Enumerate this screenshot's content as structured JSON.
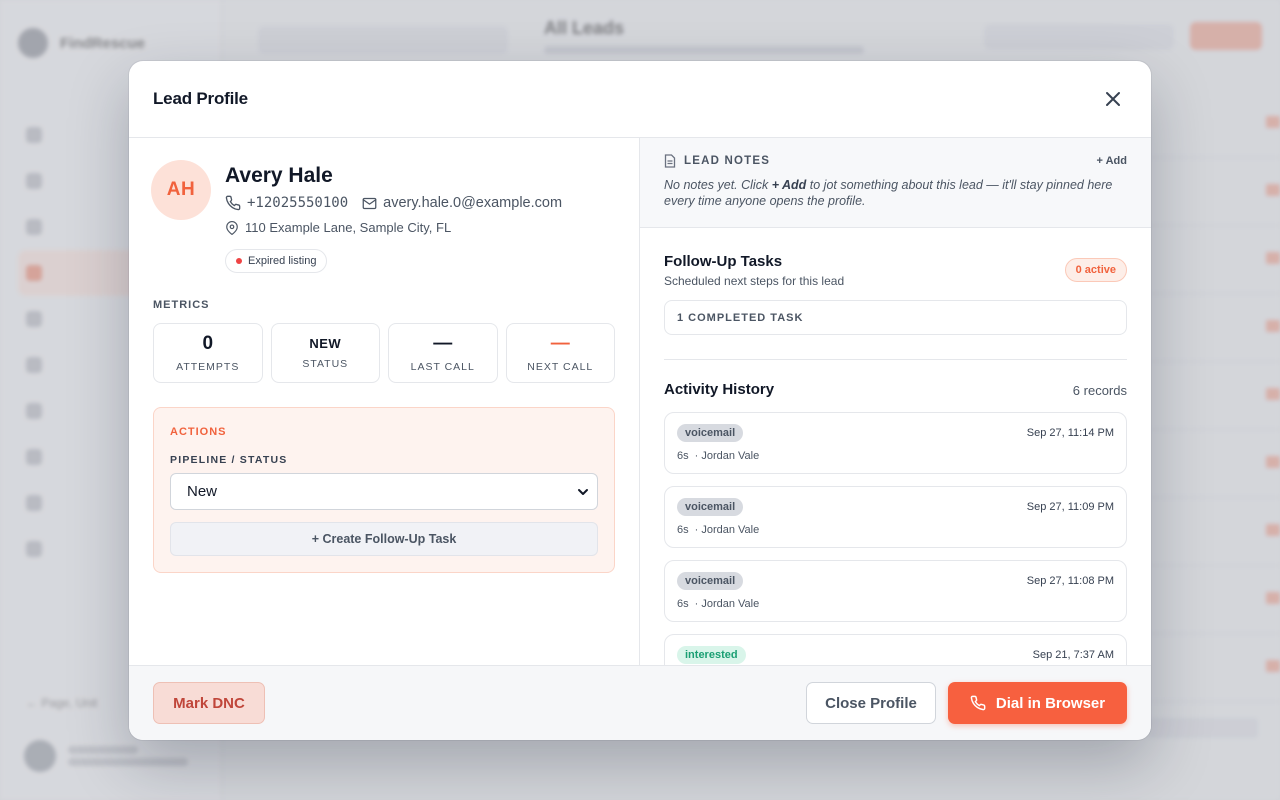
{
  "background": {
    "brand": "FindRescue",
    "page_title": "All Leads",
    "footer_link": "← Page, Unit"
  },
  "modal": {
    "title": "Lead Profile",
    "lead": {
      "initials": "AH",
      "name": "Avery Hale",
      "phone": "+12025550100",
      "email": "avery.hale.0@example.com",
      "address": "110 Example Lane, Sample City, FL",
      "tag": "Expired listing"
    },
    "metrics_label": "METRICS",
    "metrics": [
      {
        "value": "0",
        "label": "ATTEMPTS"
      },
      {
        "value": "NEW",
        "label": "STATUS"
      },
      {
        "value": "—",
        "label": "LAST CALL"
      },
      {
        "value": "—",
        "label": "NEXT CALL"
      }
    ],
    "actions": {
      "label": "ACTIONS",
      "pipeline_label": "PIPELINE / STATUS",
      "selected_status": "New",
      "create_task_label": "+ Create Follow-Up Task"
    },
    "notes": {
      "title": "LEAD NOTES",
      "add_label": "+ Add",
      "empty_before": "No notes yet. Click ",
      "empty_bold": "+ Add",
      "empty_after": " to jot something about this lead — it'll stay pinned here every time anyone opens the profile."
    },
    "follow_up": {
      "title": "Follow-Up Tasks",
      "subtitle": "Scheduled next steps for this lead",
      "active_badge": "0 active",
      "completed_label": "1 COMPLETED TASK"
    },
    "activity": {
      "title": "Activity History",
      "count": "6 records",
      "records": [
        {
          "outcome": "voicemail",
          "time": "Sep 27, 11:14 PM",
          "duration": "6s",
          "agent": "· Jordan Vale"
        },
        {
          "outcome": "voicemail",
          "time": "Sep 27, 11:09 PM",
          "duration": "6s",
          "agent": "· Jordan Vale"
        },
        {
          "outcome": "voicemail",
          "time": "Sep 27, 11:08 PM",
          "duration": "6s",
          "agent": "· Jordan Vale"
        },
        {
          "outcome": "interested",
          "time": "Sep 21, 7:37 AM",
          "duration": "",
          "agent": ""
        }
      ]
    },
    "footer": {
      "dnc_label": "Mark DNC",
      "close_label": "Close Profile",
      "dial_label": "Dial in Browser"
    }
  },
  "colors": {
    "accent": "#f7603f",
    "danger_bg": "#f8dcd6",
    "success": "#1a9f73"
  }
}
